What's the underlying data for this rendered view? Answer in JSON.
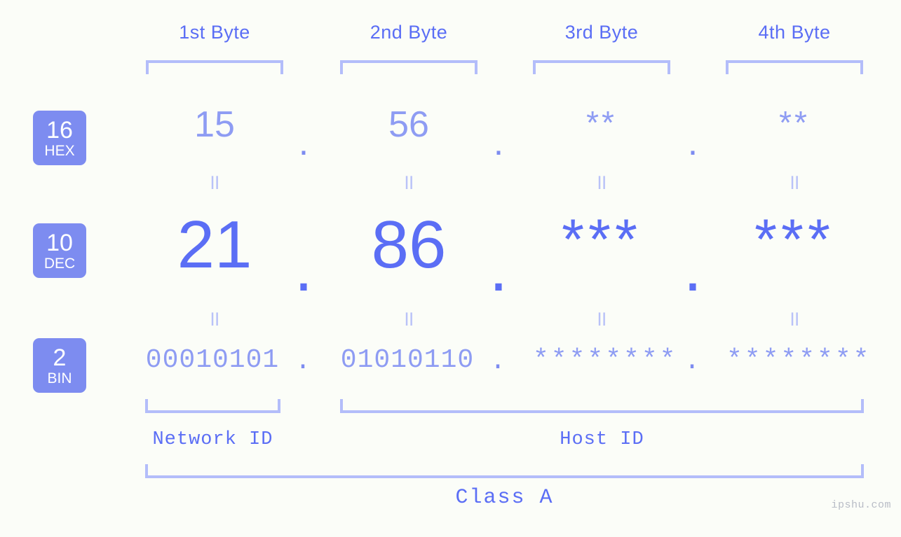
{
  "meta": {
    "background_color": "#fbfdf8",
    "accent_color": "#5b6ef5",
    "accent_light_color": "#8e9cf3",
    "bracket_color": "#b3bdfa",
    "badge_color": "#7d8cf0",
    "watermark": "ipshu.com"
  },
  "headers": {
    "byte1": "1st Byte",
    "byte2": "2nd Byte",
    "byte3": "3rd Byte",
    "byte4": "4th Byte"
  },
  "bases": [
    {
      "number": "16",
      "name": "HEX"
    },
    {
      "number": "10",
      "name": "DEC"
    },
    {
      "number": "2",
      "name": "BIN"
    }
  ],
  "rows": {
    "hex": {
      "base_number": "16",
      "base_name": "HEX",
      "values": [
        "15",
        "56",
        "**",
        "**"
      ],
      "separators": [
        ".",
        ".",
        "."
      ]
    },
    "dec": {
      "base_number": "10",
      "base_name": "DEC",
      "values": [
        "21",
        "86",
        "***",
        "***"
      ],
      "separators": [
        ".",
        ".",
        "."
      ]
    },
    "bin": {
      "base_number": "2",
      "base_name": "BIN",
      "values": [
        "00010101",
        "01010110",
        "********",
        "********"
      ],
      "separators": [
        ".",
        ".",
        "."
      ]
    }
  },
  "equals": {
    "mark": "॥",
    "between_hex_dec": [
      "॥",
      "॥",
      "॥",
      "॥"
    ],
    "between_dec_bin": [
      "॥",
      "॥",
      "॥",
      "॥"
    ]
  },
  "footer": {
    "network_id": "Network ID",
    "host_id": "Host ID",
    "class": "Class A"
  }
}
